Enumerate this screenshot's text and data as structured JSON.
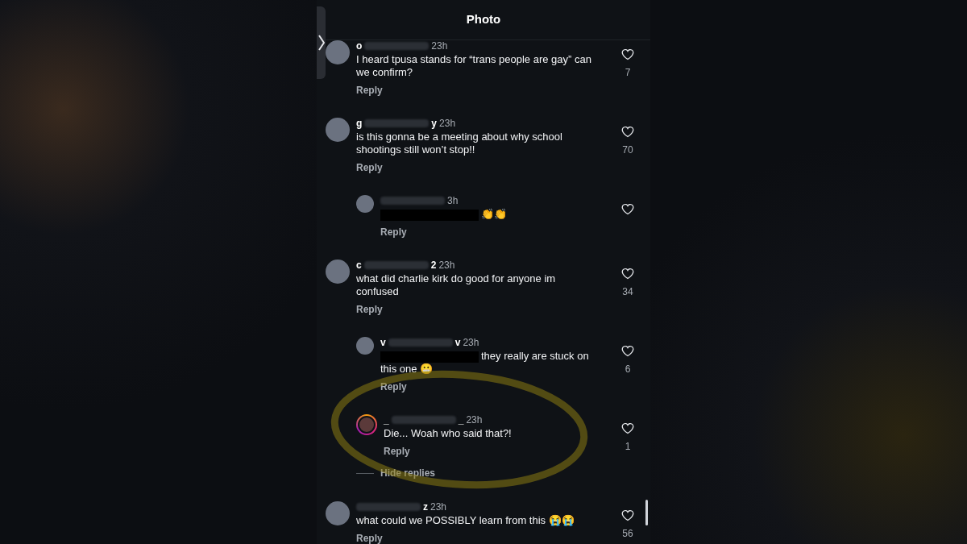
{
  "header": {
    "title": "Photo"
  },
  "comments": [
    {
      "name_head": "o",
      "time": "23h",
      "text": "I heard tpusa stands for “trans people are gay” can we confirm?",
      "reply_label": "Reply",
      "likes": "7",
      "story_ring": false
    },
    {
      "name_head": "g",
      "name_tail": "y",
      "time": "23h",
      "text": "is this gonna be a meeting about why school shootings still won’t stop!!",
      "reply_label": "Reply",
      "likes": "70",
      "story_ring": false,
      "children": [
        {
          "time": "3h",
          "redacted_prefix": true,
          "text": "👏👏",
          "reply_label": "Reply",
          "story_ring": false
        }
      ]
    },
    {
      "name_head": "c",
      "name_tail": "2",
      "time": "23h",
      "text": "what did charlie kirk do good for anyone im confused",
      "reply_label": "Reply",
      "likes": "34",
      "story_ring": false,
      "hide_replies_label": "Hide replies",
      "children": [
        {
          "name_head": "v",
          "name_tail": "v",
          "time": "23h",
          "redacted_prefix": true,
          "text": "they really are stuck on this one 😬",
          "reply_label": "Reply",
          "likes": "6",
          "story_ring": false
        },
        {
          "name_head": "_",
          "name_tail": "_",
          "time": "23h",
          "text": "Die... Woah who said that?!",
          "reply_label": "Reply",
          "likes": "1",
          "story_ring": true,
          "circled": true
        }
      ]
    },
    {
      "name_tail": "z",
      "time": "23h",
      "text": "what could we POSSIBLY learn from this 😭😭",
      "reply_label": "Reply",
      "likes": "56",
      "story_ring": false
    }
  ]
}
